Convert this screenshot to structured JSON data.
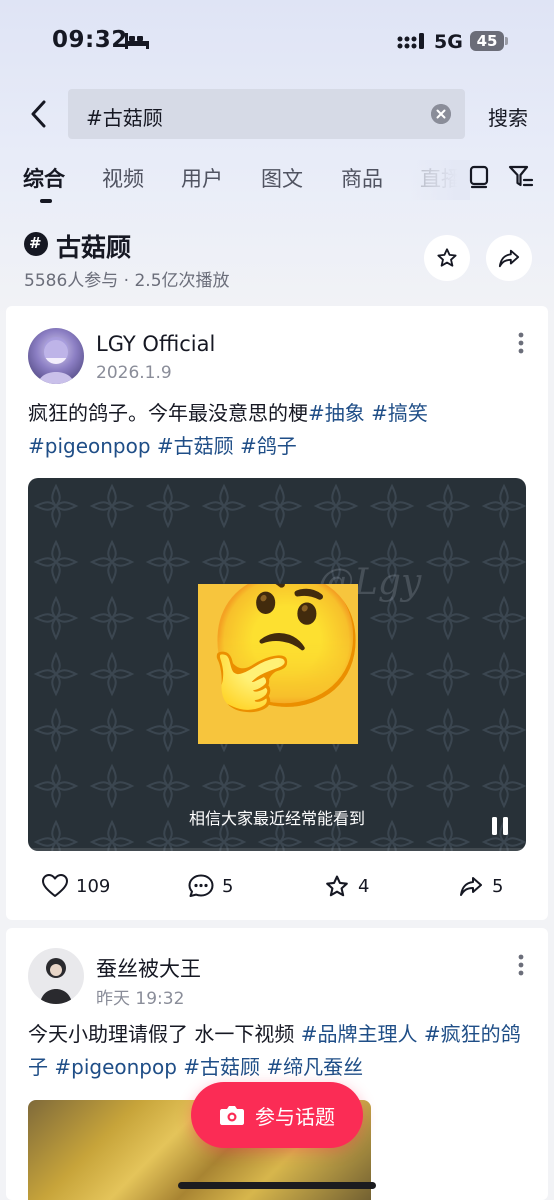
{
  "status_bar": {
    "time": "09:32",
    "network": "5G",
    "battery": "45"
  },
  "search": {
    "query": "#古菇顾",
    "button_label": "搜索"
  },
  "tabs": [
    {
      "label": "综合",
      "active": true
    },
    {
      "label": "视频"
    },
    {
      "label": "用户"
    },
    {
      "label": "图文"
    },
    {
      "label": "商品"
    },
    {
      "label": "直播"
    }
  ],
  "topic": {
    "title": "古菇顾",
    "participants": "5586人参与",
    "plays": "2.5亿次播放"
  },
  "posts": [
    {
      "author": "LGY Official",
      "date": "2026.1.9",
      "text": "疯狂的鸽子。今年最没意思的梗",
      "tags": [
        "#抽象",
        "#搞笑",
        "#pigeonpop",
        "#古菇顾",
        "#鸽子"
      ],
      "video_caption": "相信大家最近经常能看到",
      "watermark": "@Lgy",
      "emoji": "🤔",
      "likes": "109",
      "comments": "5",
      "favorites": "4",
      "shares": "5"
    },
    {
      "author": "蚕丝被大王",
      "date": "昨天 19:32",
      "text": "今天小助理请假了 水一下视频",
      "tags": [
        "#品牌主理人",
        "#疯狂的鸽子",
        "#pigeonpop",
        "#古菇顾",
        "#缔凡蚕丝"
      ]
    }
  ],
  "join_button": {
    "label": "参与话题"
  },
  "colors": {
    "accent": "#fb2c55",
    "tag": "#1f4e87",
    "background": "#f2f3f6"
  },
  "icons": [
    "back-icon",
    "clear-icon",
    "list-icon",
    "filter-icon",
    "topic-icon",
    "star-icon",
    "share-icon",
    "more-icon",
    "heart-icon",
    "comment-icon",
    "camera-icon",
    "pause-icon"
  ]
}
